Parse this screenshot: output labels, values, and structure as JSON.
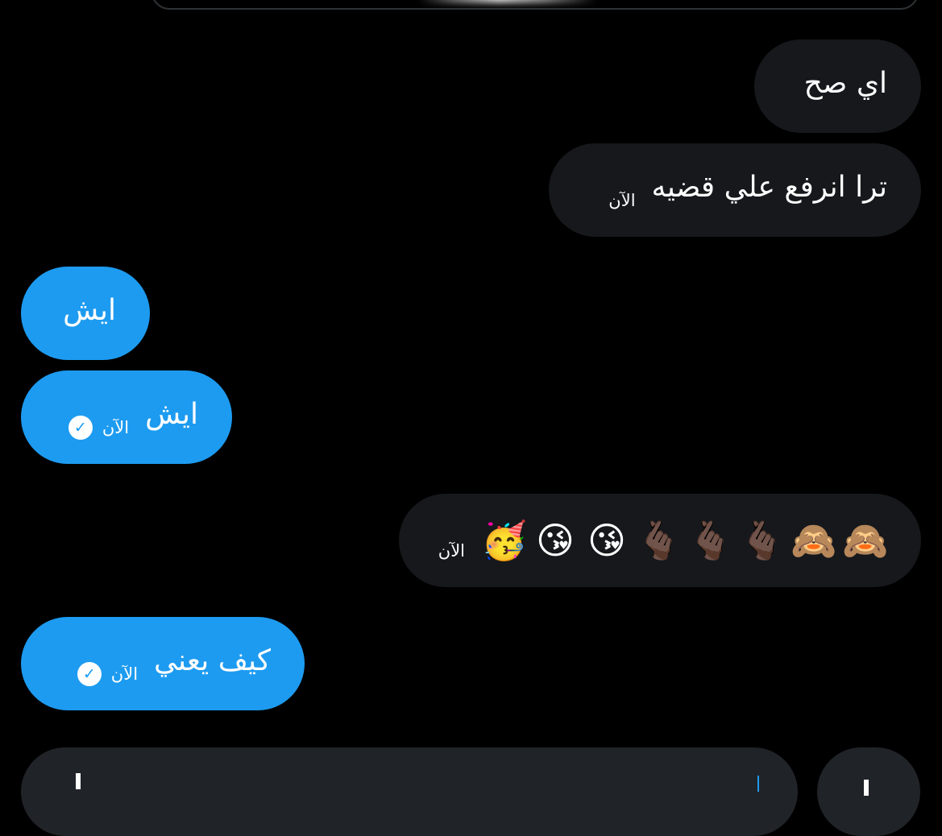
{
  "conversation": {
    "messages": [
      {
        "direction": "received",
        "text": "اي صح",
        "time": ""
      },
      {
        "direction": "received",
        "text": "ترا انرفع علي قضيه",
        "time": "الآن"
      },
      {
        "direction": "sent",
        "text": "ايش",
        "time": ""
      },
      {
        "direction": "sent",
        "text": "ايش",
        "time": "الآن",
        "status": "read"
      },
      {
        "direction": "received",
        "emojis": [
          "🥳",
          "😘",
          "😘",
          "🫰🏿",
          "🫰🏿",
          "🫰🏿",
          "🙈",
          "🙈"
        ],
        "time": "الآن"
      },
      {
        "direction": "sent",
        "text": "كيف يعني",
        "time": "الآن",
        "status": "read"
      }
    ]
  },
  "icons": {
    "read_receipt": "check-circle-icon",
    "send": "send-icon"
  },
  "colors": {
    "background": "#000000",
    "received_bubble": "#16181c",
    "sent_bubble": "#1d9bf0",
    "text": "#ffffff"
  }
}
